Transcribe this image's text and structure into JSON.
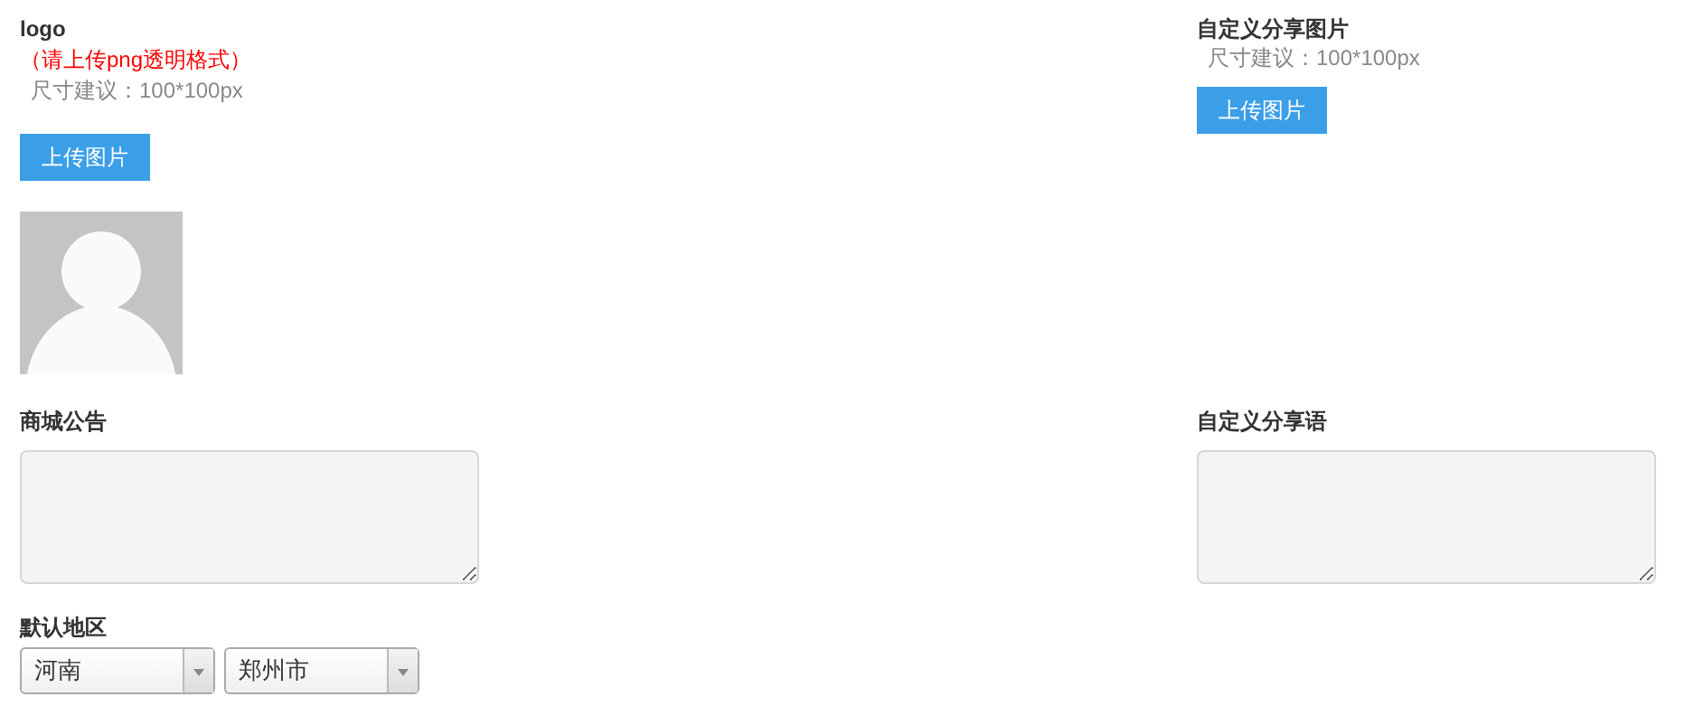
{
  "logo": {
    "title": "logo",
    "note": "（请上传png透明格式）",
    "hint": "尺寸建议：100*100px",
    "button": "上传图片"
  },
  "share_image": {
    "title": "自定义分享图片",
    "hint": "尺寸建议：100*100px",
    "button": "上传图片"
  },
  "notice": {
    "label": "商城公告"
  },
  "share_text": {
    "label": "自定义分享语"
  },
  "region": {
    "label": "默认地区",
    "selects": [
      {
        "value": "河南"
      },
      {
        "value": "郑州市"
      }
    ]
  }
}
